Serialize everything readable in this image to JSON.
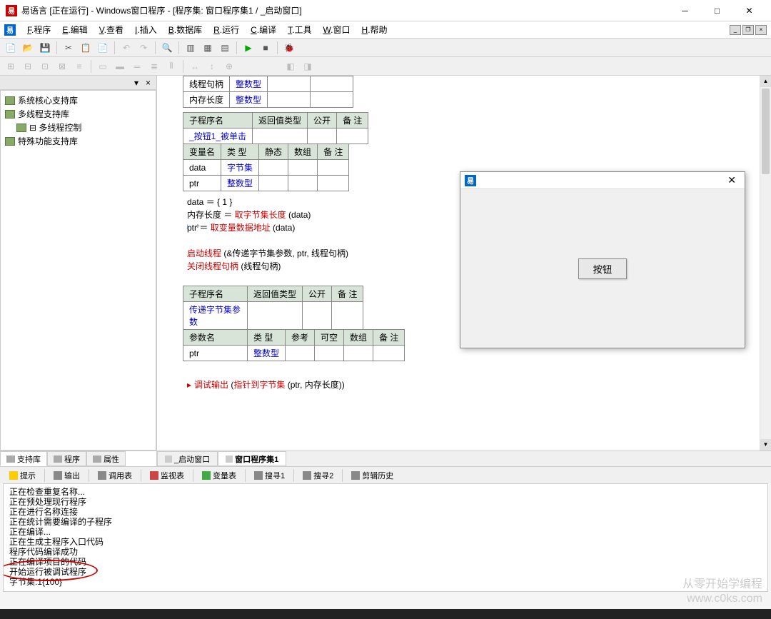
{
  "window": {
    "title": "易语言 [正在运行] - Windows窗口程序 - [程序集: 窗口程序集1 / _启动窗口]"
  },
  "menu": {
    "items": [
      {
        "key": "F",
        "label": "程序"
      },
      {
        "key": "E",
        "label": "编辑"
      },
      {
        "key": "V",
        "label": "查看"
      },
      {
        "key": "I",
        "label": "插入"
      },
      {
        "key": "B",
        "label": "数据库"
      },
      {
        "key": "R",
        "label": "运行"
      },
      {
        "key": "C",
        "label": "编译"
      },
      {
        "key": "T",
        "label": "工具"
      },
      {
        "key": "W",
        "label": "窗口"
      },
      {
        "key": "H",
        "label": "帮助"
      }
    ]
  },
  "sidebar": {
    "items": [
      "系统核心支持库",
      "多线程支持库",
      "⊟ 多线程控制",
      "特殊功能支持库"
    ],
    "tabs": [
      "支持库",
      "程序",
      "属性"
    ]
  },
  "editor": {
    "table1": {
      "rows": [
        {
          "name": "线程句柄",
          "type": "整数型"
        },
        {
          "name": "内存长度",
          "type": "整数型"
        }
      ]
    },
    "table2": {
      "headers": [
        "子程序名",
        "返回值类型",
        "公开",
        "备 注"
      ],
      "row": "_按钮1_被单击"
    },
    "table2b": {
      "headers": [
        "变量名",
        "类 型",
        "静态",
        "数组",
        "备 注"
      ],
      "rows": [
        {
          "name": "data",
          "type": "字节集"
        },
        {
          "name": "ptr",
          "type": "整数型"
        }
      ]
    },
    "code1": [
      {
        "t": "data ＝ { 1 }",
        "cls": ""
      },
      {
        "t": "内存长度 ＝ ",
        "fn": "取字节集长度",
        "args": " (data)"
      },
      {
        "t": "ptr ＝ ",
        "fn": "取变量数据地址",
        "args": " (data)"
      }
    ],
    "code2": [
      {
        "fn": "启动线程",
        "args": " (&传递字节集参数, ptr, 线程句柄)"
      },
      {
        "fn": "关闭线程句柄",
        "args": " (线程句柄)"
      }
    ],
    "table3": {
      "headers": [
        "子程序名",
        "返回值类型",
        "公开",
        "备 注"
      ],
      "row": "传递字节集参数"
    },
    "table3b": {
      "headers": [
        "参数名",
        "类 型",
        "参考",
        "可空",
        "数组",
        "备 注"
      ],
      "rows": [
        {
          "name": "ptr",
          "type": "整数型"
        }
      ]
    },
    "code3": {
      "fn": "调试输出",
      "args": " (",
      "fn2": "指针到字节集",
      "args2": " (ptr, 内存长度))"
    },
    "tabs": [
      "_启动窗口",
      "窗口程序集1"
    ]
  },
  "bottom_tabs": [
    "提示",
    "输出",
    "调用表",
    "监视表",
    "变量表",
    "搜寻1",
    "搜寻2",
    "剪辑历史"
  ],
  "output": {
    "lines": [
      "正在检查重复名称...",
      "正在预处理现行程序",
      "正在进行名称连接",
      "正在统计需要编译的子程序",
      "正在编译...",
      "正在生成主程序入口代码",
      "程序代码编译成功",
      "正在编译项目的代码",
      "开始运行被调试程序",
      "字节集:1{100}"
    ]
  },
  "float_window": {
    "button": "按钮"
  },
  "watermark": {
    "line1": "从零开始学编程",
    "line2": "www.c0ks.com"
  }
}
